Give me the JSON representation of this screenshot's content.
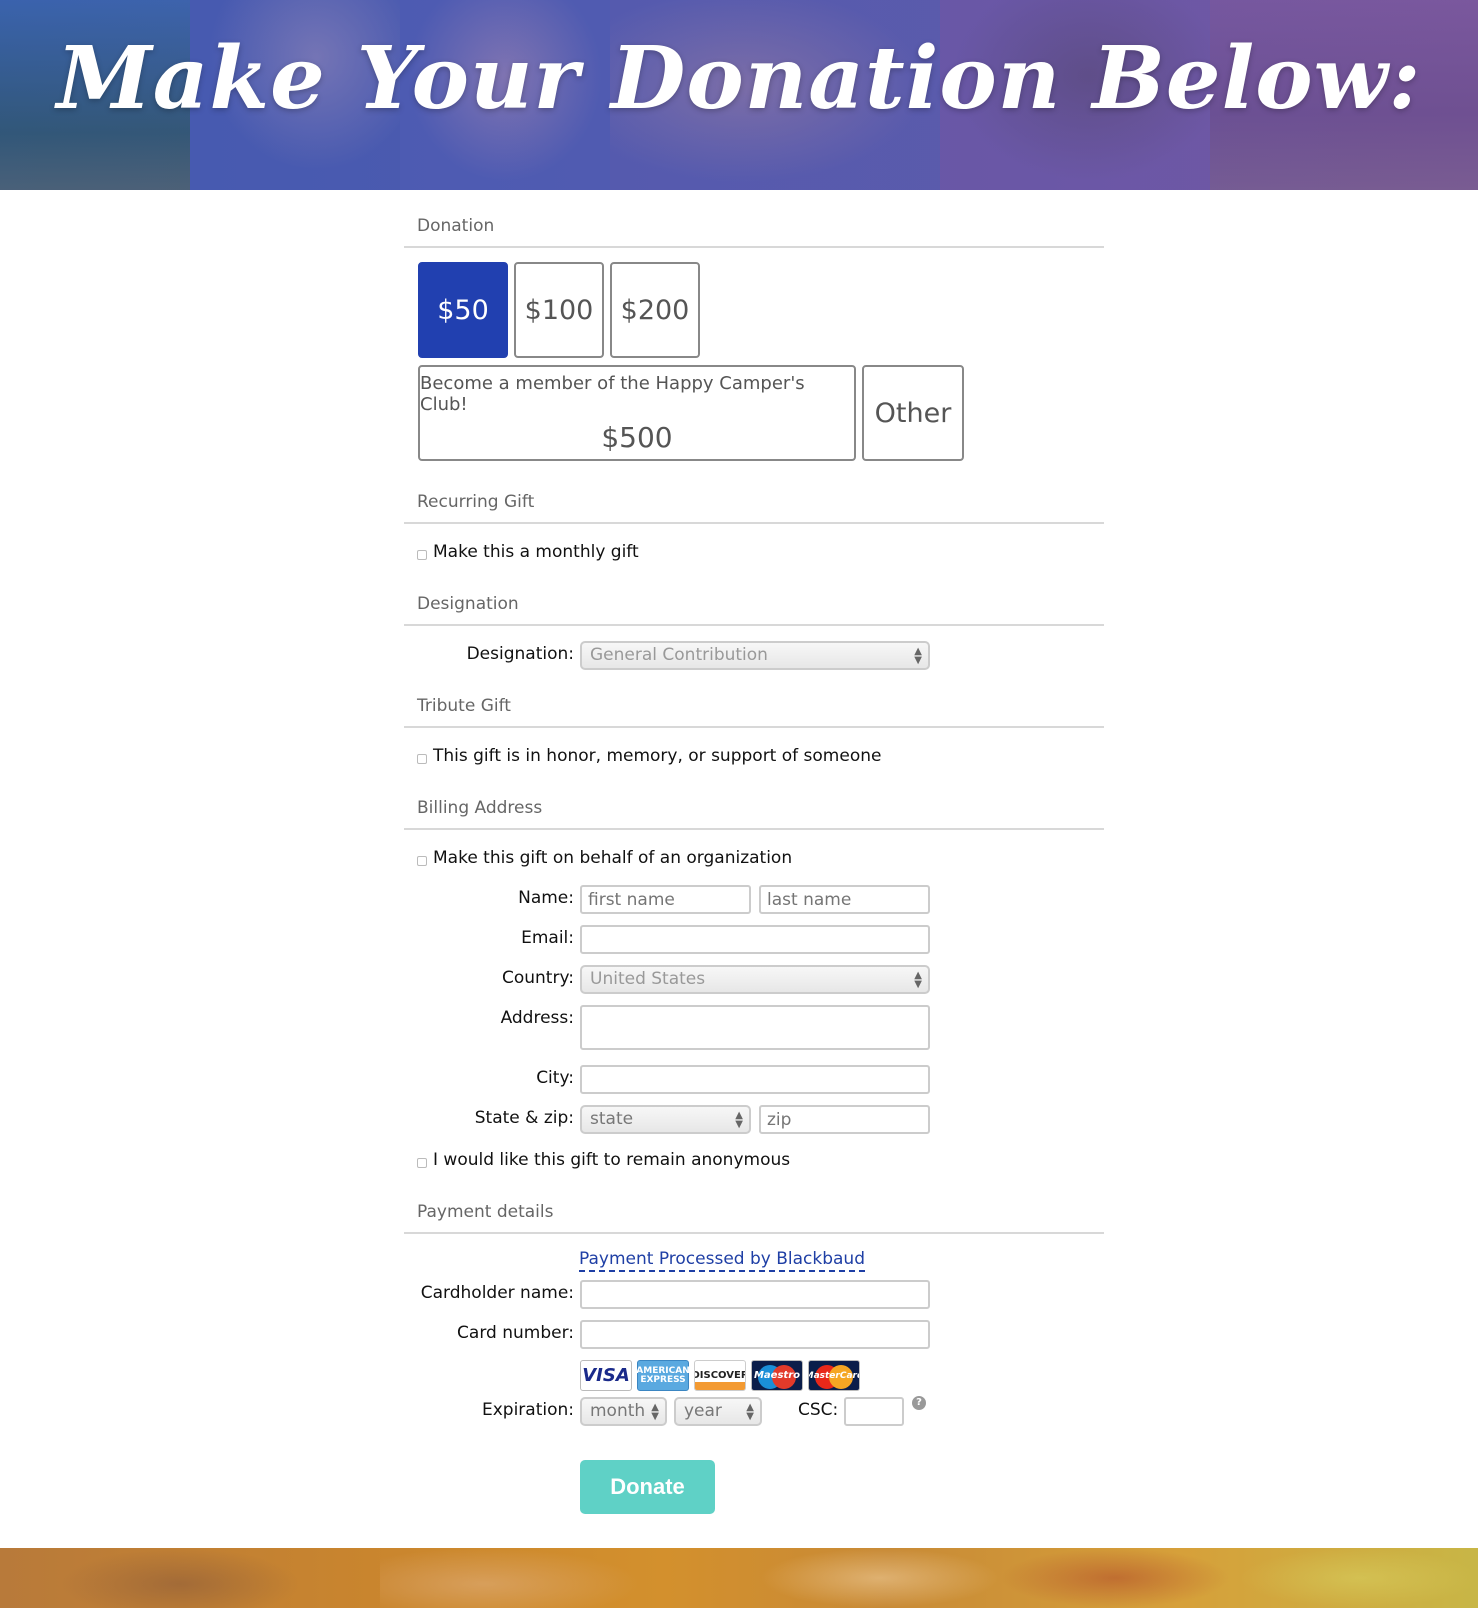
{
  "banner": {
    "title": "Make Your Donation Below:"
  },
  "sections": {
    "donation": "Donation",
    "recurring": "Recurring Gift",
    "designation": "Designation",
    "tribute": "Tribute Gift",
    "billing": "Billing Address",
    "payment": "Payment details"
  },
  "amounts": [
    {
      "label": "$50",
      "selected": true
    },
    {
      "label": "$100",
      "selected": false
    },
    {
      "label": "$200",
      "selected": false
    }
  ],
  "club": {
    "text": "Become a member of the Happy Camper's Club!",
    "amount": "$500"
  },
  "other_label": "Other",
  "recurring": {
    "checkbox_label": "Make this a monthly gift",
    "checked": false
  },
  "designation": {
    "label": "Designation:",
    "selected": "General Contribution"
  },
  "tribute": {
    "checkbox_label": "This gift is in honor, memory, or support of someone",
    "checked": false
  },
  "billing": {
    "organization_label": "Make this gift on behalf of an organization",
    "name_label": "Name:",
    "first_placeholder": "first name",
    "last_placeholder": "last name",
    "email_label": "Email:",
    "country_label": "Country:",
    "country_selected": "United States",
    "address_label": "Address:",
    "city_label": "City:",
    "state_zip_label": "State & zip:",
    "state_placeholder": "state",
    "zip_placeholder": "zip",
    "anonymous_label": "I would like this gift to remain anonymous"
  },
  "payment": {
    "processor_link": "Payment Processed by Blackbaud",
    "cardholder_label": "Cardholder name:",
    "card_number_label": "Card number:",
    "cards": [
      {
        "name": "visa-icon",
        "text": "VISA"
      },
      {
        "name": "amex-icon",
        "text": "AMERICAN EXPRESS"
      },
      {
        "name": "discover-icon",
        "text": "DISCOVER"
      },
      {
        "name": "maestro-icon",
        "text": "Maestro"
      },
      {
        "name": "mastercard-icon",
        "text": "MasterCard"
      }
    ],
    "expiration_label": "Expiration:",
    "month_placeholder": "month",
    "year_placeholder": "year",
    "csc_label": "CSC:",
    "help_icon": "?"
  },
  "donate_button": "Donate",
  "colors": {
    "selected_amount": "#2140b0",
    "donate_button": "#5fd1c6",
    "link": "#1f3fa5"
  }
}
